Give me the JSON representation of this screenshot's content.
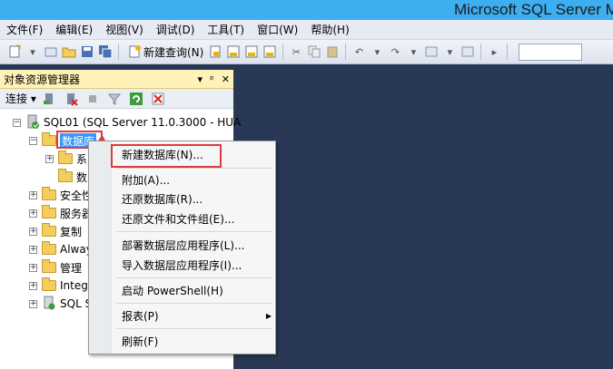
{
  "window": {
    "title": "Microsoft SQL Server Ma"
  },
  "menubar": {
    "items": [
      "文件(F)",
      "编辑(E)",
      "视图(V)",
      "调试(D)",
      "工具(T)",
      "窗口(W)",
      "帮助(H)"
    ]
  },
  "toolbar": {
    "new_query_label": "新建查询(N)"
  },
  "object_explorer": {
    "title": "对象资源管理器",
    "header_controls": [
      "▾",
      "ᵖ",
      "✕"
    ],
    "connect_label": "连接",
    "server_node": "SQL01 (SQL Server 11.0.3000 - HUA",
    "databases_node": "数据库",
    "db_children": [
      "系",
      "数"
    ],
    "top_nodes": [
      "安全性",
      "服务器",
      "复制",
      "Alway",
      "管理",
      "Integ",
      "SQL S"
    ]
  },
  "context_menu": {
    "items": [
      "新建数据库(N)...",
      "附加(A)...",
      "还原数据库(R)...",
      "还原文件和文件组(E)...",
      "部署数据层应用程序(L)...",
      "导入数据层应用程序(I)...",
      "启动 PowerShell(H)",
      "报表(P)",
      "刷新(F)"
    ]
  },
  "colors": {
    "titlebar": "#3daef0",
    "workspace": "#293955",
    "panel_header": "#fff2b8",
    "selection": "#3399ff",
    "highlight": "#e03a3a"
  }
}
